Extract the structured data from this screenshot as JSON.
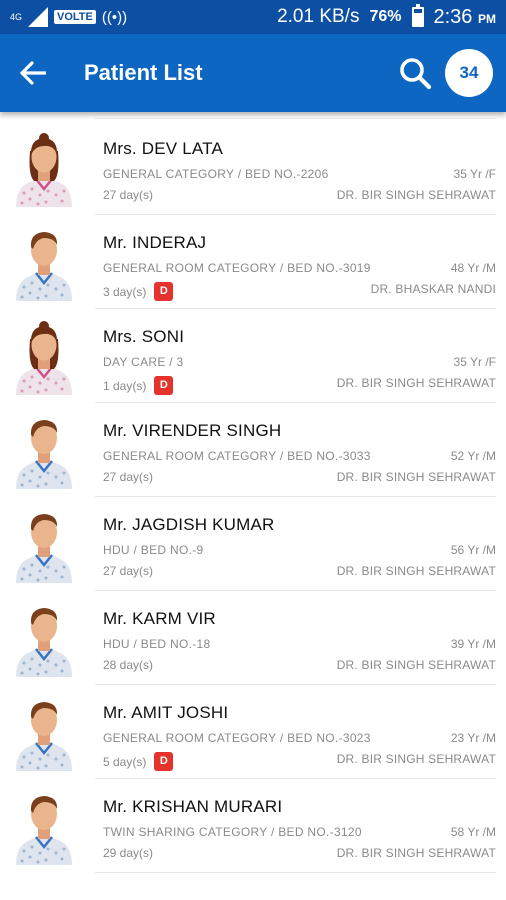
{
  "status_bar": {
    "network": "4G",
    "volte": "VOLTE",
    "speed": "2.01 KB/s",
    "battery_pct": "76%",
    "battery_level": 0.76,
    "time": "2:36",
    "ampm": "PM"
  },
  "app_bar": {
    "title": "Patient List",
    "count": "34"
  },
  "colors": {
    "status_bar": "#0c4fa3",
    "app_bar": "#0c66c2",
    "badge_red": "#e5322c"
  },
  "patients": [
    {
      "name": "Mrs. DEV LATA",
      "category": "GENERAL CATEGORY / BED NO.-2206",
      "age": "35 Yr /F",
      "days": "27 day(s)",
      "badge": "",
      "doctor": "DR. BIR SINGH SEHRAWAT",
      "gender": "female"
    },
    {
      "name": "Mr. INDERAJ",
      "category": "GENERAL ROOM CATEGORY / BED NO.-3019",
      "age": "48 Yr /M",
      "days": "3 day(s)",
      "badge": "D",
      "doctor": "DR. BHASKAR NANDI",
      "gender": "male"
    },
    {
      "name": "Mrs. SONI",
      "category": "DAY CARE / 3",
      "age": "35 Yr /F",
      "days": "1 day(s)",
      "badge": "D",
      "doctor": "DR. BIR SINGH SEHRAWAT",
      "gender": "female"
    },
    {
      "name": "Mr. VIRENDER  SINGH",
      "category": "GENERAL ROOM CATEGORY / BED NO.-3033",
      "age": "52 Yr /M",
      "days": "27 day(s)",
      "badge": "",
      "doctor": "DR. BIR SINGH SEHRAWAT",
      "gender": "male"
    },
    {
      "name": "Mr. JAGDISH KUMAR",
      "category": "HDU / BED NO.-9",
      "age": "56 Yr /M",
      "days": "27 day(s)",
      "badge": "",
      "doctor": "DR. BIR SINGH SEHRAWAT",
      "gender": "male"
    },
    {
      "name": "Mr. KARM VIR",
      "category": "HDU / BED NO.-18",
      "age": "39 Yr /M",
      "days": "28 day(s)",
      "badge": "",
      "doctor": "DR. BIR SINGH SEHRAWAT",
      "gender": "male"
    },
    {
      "name": "Mr. AMIT JOSHI",
      "category": "GENERAL ROOM CATEGORY / BED NO.-3023",
      "age": "23 Yr /M",
      "days": "5 day(s)",
      "badge": "D",
      "doctor": "DR. BIR SINGH SEHRAWAT",
      "gender": "male"
    },
    {
      "name": "Mr. KRISHAN MURARI",
      "category": "TWIN SHARING CATEGORY / BED NO.-3120",
      "age": "58 Yr /M",
      "days": "29 day(s)",
      "badge": "",
      "doctor": "DR. BIR SINGH SEHRAWAT",
      "gender": "male"
    }
  ]
}
